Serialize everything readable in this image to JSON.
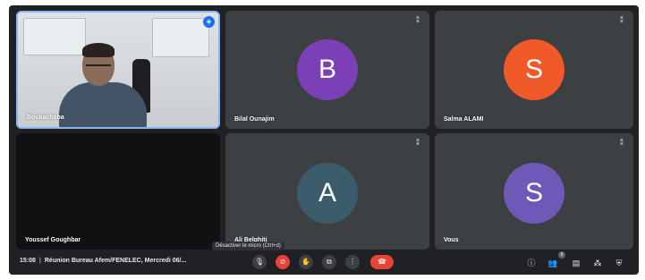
{
  "participants": [
    {
      "name": "Boukachaba",
      "type": "video"
    },
    {
      "name": "Bilal Ounajim",
      "initial": "B",
      "color": "#7b3fb6"
    },
    {
      "name": "Salma ALAMI",
      "initial": "S",
      "color": "#f05a28"
    },
    {
      "name": "Youssef Goughbar",
      "type": "camera-off"
    },
    {
      "name": "Ali Belghiti",
      "initial": "A",
      "color": "#3b5d6b"
    },
    {
      "name": "Vous",
      "initial": "S",
      "color": "#6e58b8"
    }
  ],
  "bottom_bar": {
    "time": "15:08",
    "meeting_title": "Réunion Bureau Afem/FENELEC, Mercredi 06/...",
    "tooltip": "Désactiver le micro (Ctrl+d)",
    "participants_count": "6"
  },
  "icons": {
    "mic": "mic-icon",
    "camera_off": "camera-off-icon",
    "hand": "raise-hand-icon",
    "present": "present-icon",
    "more": "more-options-icon",
    "hangup": "hangup-icon",
    "info": "info-icon",
    "people": "people-icon",
    "chat": "chat-icon",
    "activities": "activities-icon",
    "host": "host-controls-icon"
  },
  "colors": {
    "background": "#202124",
    "tile": "#3c4043",
    "accent_blue": "#8ab4f8",
    "danger": "#ea4335"
  }
}
